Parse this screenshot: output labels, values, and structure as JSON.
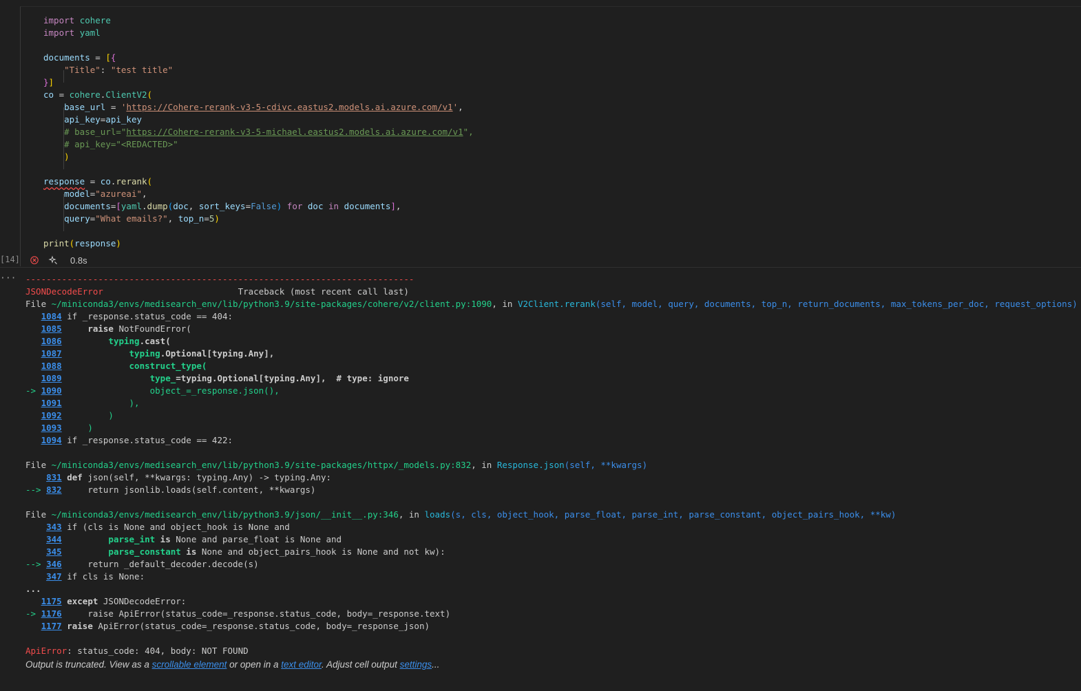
{
  "code": {
    "imports": [
      "import cohere",
      "import yaml"
    ],
    "documents_line": "documents = [{",
    "title_key": "\"Title\"",
    "title_value": "\"test title\"",
    "docs_close": "}]",
    "co_assign": "co = cohere.ClientV2(",
    "base_url_kw": "base_url = '",
    "base_url_value": "https://Cohere-rerank-v3-5-cdivc.eastus2.models.ai.azure.com/v1",
    "base_url_end": "',",
    "api_key_line": "api_key=api_key",
    "comment_base_url_pre": "# base_url=\"",
    "comment_base_url_value": "https://Cohere-rerank-v3-5-michael.eastus2.models.ai.azure.com/v1",
    "comment_base_url_post": "\",",
    "comment_api_key": "# api_key=\"<REDACTED>\"",
    "close_paren": ")",
    "response_var": "response",
    "rerank_call": " = co.rerank(",
    "model_line_kw": "model=",
    "model_value": "\"azureai\"",
    "documents_kw": "documents=[yaml.dump(doc, sort_keys=",
    "false_kw": "False",
    "documents_tail": ") for doc in documents],",
    "query_kw": "query=",
    "query_value": "\"What emails?\"",
    "top_n_kw": ", top_n=",
    "top_n_value": "5",
    "print_line": "print(response)"
  },
  "cell": {
    "execution_count": "[14]",
    "duration": "0.8s",
    "more": "···"
  },
  "traceback": {
    "dashes": "---------------------------------------------------------------------------",
    "error_name": "JSONDecodeError",
    "header": "Traceback (most recent call last)",
    "frames": [
      {
        "file_prefix": "File ",
        "path": "~/miniconda3/envs/medisearch_env/lib/python3.9/site-packages/cohere/v2/client.py:1090",
        "in": ", in ",
        "func": "V2Client.rerank",
        "args": "(self, model, query, documents, top_n, return_documents, max_tokens_per_doc, request_options)"
      },
      {
        "file_prefix": "File ",
        "path": "~/miniconda3/envs/medisearch_env/lib/python3.9/site-packages/httpx/_models.py:832",
        "in": ", in ",
        "func": "Response.json",
        "args": "(self, **kwargs)"
      },
      {
        "file_prefix": "File ",
        "path": "~/miniconda3/envs/medisearch_env/lib/python3.9/json/__init__.py:346",
        "in": ", in ",
        "func": "loads",
        "args": "(s, cls, object_hook, parse_float, parse_int, parse_constant, object_pairs_hook, **kw)"
      }
    ],
    "f1": {
      "l1084": "1084",
      "t1084": " if _response.status_code == 404:",
      "l1085": "1085",
      "t1085a": "     raise",
      "t1085b": " NotFoundError(",
      "l1086": "1086",
      "t1086a": "         typing",
      "t1086b": ".cast(",
      "l1087": "1087",
      "t1087a": "             typing",
      "t1087b": ".Optional[typing.Any],",
      "l1088": "1088",
      "t1088": "             construct_type(",
      "l1089": "1089",
      "t1089a": "                 type_",
      "t1089b": "=typing.Optional[typing.Any],  # type: ignore",
      "arrow1090": "-> ",
      "l1090": "1090",
      "t1090": "                 object_=_response.json(),",
      "l1091": "1091",
      "t1091": "             ),",
      "l1092": "1092",
      "t1092": "         )",
      "l1093": "1093",
      "t1093": "     )",
      "l1094": "1094",
      "t1094": " if _response.status_code == 422:"
    },
    "f2": {
      "l831": "831",
      "t831a": " def",
      "t831b": " json(self, **kwargs: typing.Any) -> typing.Any:",
      "arrow832": "--> ",
      "l832": "832",
      "t832": "     return jsonlib.loads(self.content, **kwargs)"
    },
    "f3": {
      "l343": "343",
      "t343": " if (cls is None and object_hook is None and",
      "l344": "344",
      "t344a": "         parse_int",
      "t344b": " is",
      "t344c": " None and parse_float is None and",
      "l345": "345",
      "t345a": "         parse_constant",
      "t345b": " is",
      "t345c": " None and object_pairs_hook is None and not kw):",
      "arrow346": "--> ",
      "l346": "346",
      "t346": "     return _default_decoder.decode(s)",
      "l347": "347",
      "t347": " if cls is None:"
    },
    "ellipsis": "...",
    "f4": {
      "l1175": "1175",
      "t1175a": " except",
      "t1175b": " JSONDecodeError:",
      "arrow1176": "-> ",
      "l1176": "1176",
      "t1176": "     raise ApiError(status_code=_response.status_code, body=_response.text)",
      "l1177": "1177",
      "t1177a": " raise",
      "t1177b": " ApiError(status_code=_response.status_code, body=_response_json)"
    },
    "final_error_name": "ApiError",
    "final_error_msg": ": status_code: 404, body: NOT FOUND"
  },
  "footer": {
    "text1": "Output is truncated. View as a ",
    "link1": "scrollable element",
    "text2": " or open in a ",
    "link2": "text editor",
    "text3": ". Adjust cell output ",
    "link3": "settings",
    "text4": "..."
  }
}
